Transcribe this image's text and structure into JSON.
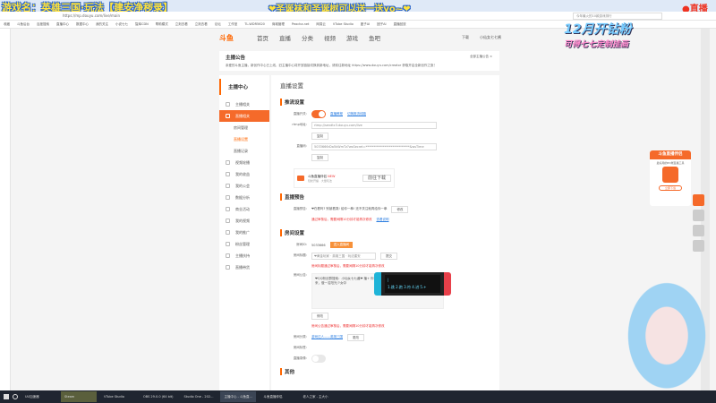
{
  "overlay": {
    "game_title": "游戏名：英雄三国·玩法【建安净秽录】",
    "greeting": "❤圣诞袜和圣诞树可以送一送yo~❤",
    "live": "●直播",
    "banner_line1": "12月开钻粉",
    "banner_line2": "可得七七定制挂画"
  },
  "browser": {
    "url": "https://mp.douyu.com/live/main",
    "search_placeholder": "今年最火的10款游戏排行",
    "bookmarks": [
      "收藏",
      "斗鱼后台",
      "百度搜索",
      "直播中心",
      "数据中心",
      "我的关注",
      "小说七七",
      "智库CDN",
      "帮助模式",
      "立刻去看",
      "立刻去看",
      "论坛",
      "工作室",
      "TL-WDR5620",
      "商城管理",
      "Peacha.net",
      "网易云",
      "VTube Studio",
      "团子AI",
      "团子AI",
      "直播回放"
    ]
  },
  "douyu": {
    "logo": "斗鱼",
    "nav": [
      "首页",
      "直播",
      "分类",
      "视频",
      "游戏",
      "鱼吧"
    ],
    "download": "下载",
    "user": "小仙女七七酱"
  },
  "notice": {
    "title": "主播公告",
    "desc": "亲爱的斗鱼主播，新创作中心已上线，旧主播中心将开放链接切换到新地址，请前往新地址 https://www.douyu.com/creator 获取开启全新创作之旅！",
    "all": "全部主播公告 ×"
  },
  "sidebar": {
    "title": "主播中心",
    "items": [
      {
        "label": "主播相关",
        "active": false
      },
      {
        "label": "直播相关",
        "active": true
      }
    ],
    "subs": [
      "房间管理",
      "直播设置",
      "直播记录"
    ],
    "items2": [
      "视频轮播",
      "我的收益",
      "我的公会",
      "数据分析",
      "商业活动",
      "我的视频",
      "我的推广",
      "粉丝管理",
      "主播扶持",
      "直播带货"
    ]
  },
  "main": {
    "title": "直播设置",
    "push": {
      "heading": "推流设置",
      "switch_label": "直播开关:",
      "tutorial": "直播教程",
      "third_party": "切换推流线路",
      "rtmp_label": "rtmp地址:",
      "rtmp_value": "rtmp://sendtc3.douyu.com/live",
      "copy": "复制",
      "code_label": "直播码:",
      "code_value": "5033666rDa5kWmTz?wsSecret=****************************&wsTime",
      "copy2": "复制",
      "tool_name": "斗鱼直播伴侣",
      "tool_new": "NEW",
      "tool_desc": "轻松开播 · 大量玩法",
      "tool_btn": "前往下载"
    },
    "preview": {
      "heading": "直播预告",
      "label": "直播预告:",
      "value": "❤在看吗? 别被看哭! 给你一拳! 还不关注就再给你一拳",
      "edit": "修改",
      "note": "通过审核后，需要间隔10分钟才能再次修改",
      "link": "查看说明"
    },
    "room": {
      "heading": "房间设置",
      "id_label": "房间ID:",
      "id_value": "5033666",
      "enter": "进入直播间",
      "title_label": "房间标题:",
      "title_value": "❤黄金玩家 · 英雄三国 · 玩法建安",
      "submit": "提交",
      "title_note": "房间标题通过审核后，需要间隔10分钟才能再次修改",
      "ann_label": "房间公告:",
      "ann_value": "❤QQ粉丝群搜索：小仙女七七酱❤ 播+ 你可爱听力。其它的都交给天意，你要喜欢的话就来，做一名阳光少女😊",
      "ann_edit": "修改",
      "ann_note": "房间公告通过审核后，需要间隔10分钟才能再次修改",
      "cat_label": "房间分类:",
      "cat_value": "游戏达人——英雄三国",
      "cat_change": "更改",
      "tag_label": "房间标签:",
      "record_label": "直播录像:",
      "next_heading": "其他"
    }
  },
  "switch_overlay": {
    "line1": "|",
    "line2": "1.跳 2.跑 3.符 4.进 5.+"
  },
  "ad": {
    "title": "斗鱼直播伴侣",
    "desc": "最好用的PC端直播工具",
    "button": "立即下载"
  },
  "taskbar": [
    "UU加速器",
    "Steam",
    "VTube Studio",
    "OBS 29.0.0 (64 bit)",
    "Studio One - 202...",
    "主播中心 - 斗鱼直...",
    "斗鱼直播伴侣",
    " 老人之家 - 主大小"
  ]
}
